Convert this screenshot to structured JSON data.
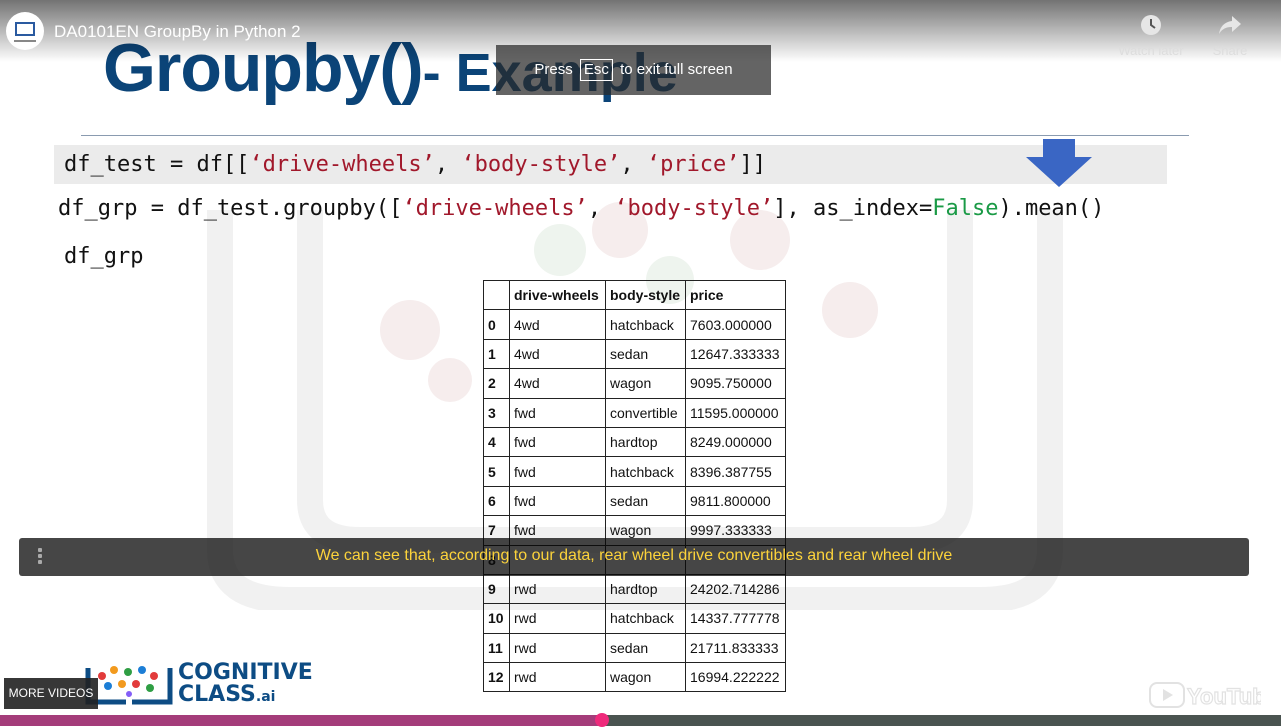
{
  "player": {
    "video_title": "DA0101EN GroupBy in Python 2",
    "watch_later_label": "Watch later",
    "share_label": "Share",
    "esc_prefix": "Press",
    "esc_key": "Esc",
    "esc_suffix": "to exit full screen",
    "caption": "We can see that, according to our data, rear wheel drive convertibles and rear wheel drive",
    "more_videos_label": "MORE VIDEOS",
    "youtube_logo_text": "YouTube",
    "progress": 0.47
  },
  "slide": {
    "title_main": "Groupby()",
    "title_rest": "- Example",
    "code_line1": {
      "a": "df_test = df[[",
      "s1": "‘drive-wheels’",
      "c1": ", ",
      "s2": "‘body-style’",
      "c2": ", ",
      "s3": "‘price’",
      "b": "]]"
    },
    "code_line2": {
      "a": "df_grp = df_test.groupby([",
      "s1": "‘drive-wheels’",
      "c1": ", ",
      "s2": "‘body-style’",
      "b": "], as_index=",
      "kw": "False",
      "c": ").mean()"
    },
    "code_line3": "df_grp",
    "table": {
      "headers": [
        "",
        "drive-wheels",
        "body-style",
        "price"
      ],
      "rows": [
        [
          "0",
          "4wd",
          "hatchback",
          "7603.000000"
        ],
        [
          "1",
          "4wd",
          "sedan",
          "12647.333333"
        ],
        [
          "2",
          "4wd",
          "wagon",
          "9095.750000"
        ],
        [
          "3",
          "fwd",
          "convertible",
          "11595.000000"
        ],
        [
          "4",
          "fwd",
          "hardtop",
          "8249.000000"
        ],
        [
          "5",
          "fwd",
          "hatchback",
          "8396.387755"
        ],
        [
          "6",
          "fwd",
          "sedan",
          "9811.800000"
        ],
        [
          "7",
          "fwd",
          "wagon",
          "9997.333333"
        ],
        [
          "8",
          "",
          "",
          ""
        ],
        [
          "9",
          "rwd",
          "hardtop",
          "24202.714286"
        ],
        [
          "10",
          "rwd",
          "hatchback",
          "14337.777778"
        ],
        [
          "11",
          "rwd",
          "sedan",
          "21711.833333"
        ],
        [
          "12",
          "rwd",
          "wagon",
          "16994.222222"
        ]
      ]
    },
    "logo": {
      "line1": "COGNITIVE",
      "line2": "CLASS",
      "suffix": ".ai"
    }
  },
  "colors": {
    "title": "#0b4478",
    "string_literal": "#a1182b",
    "keyword": "#1a9a46",
    "arrow": "#3a66c4",
    "caption": "#fcd33b",
    "progress": "#ee2a7b"
  }
}
